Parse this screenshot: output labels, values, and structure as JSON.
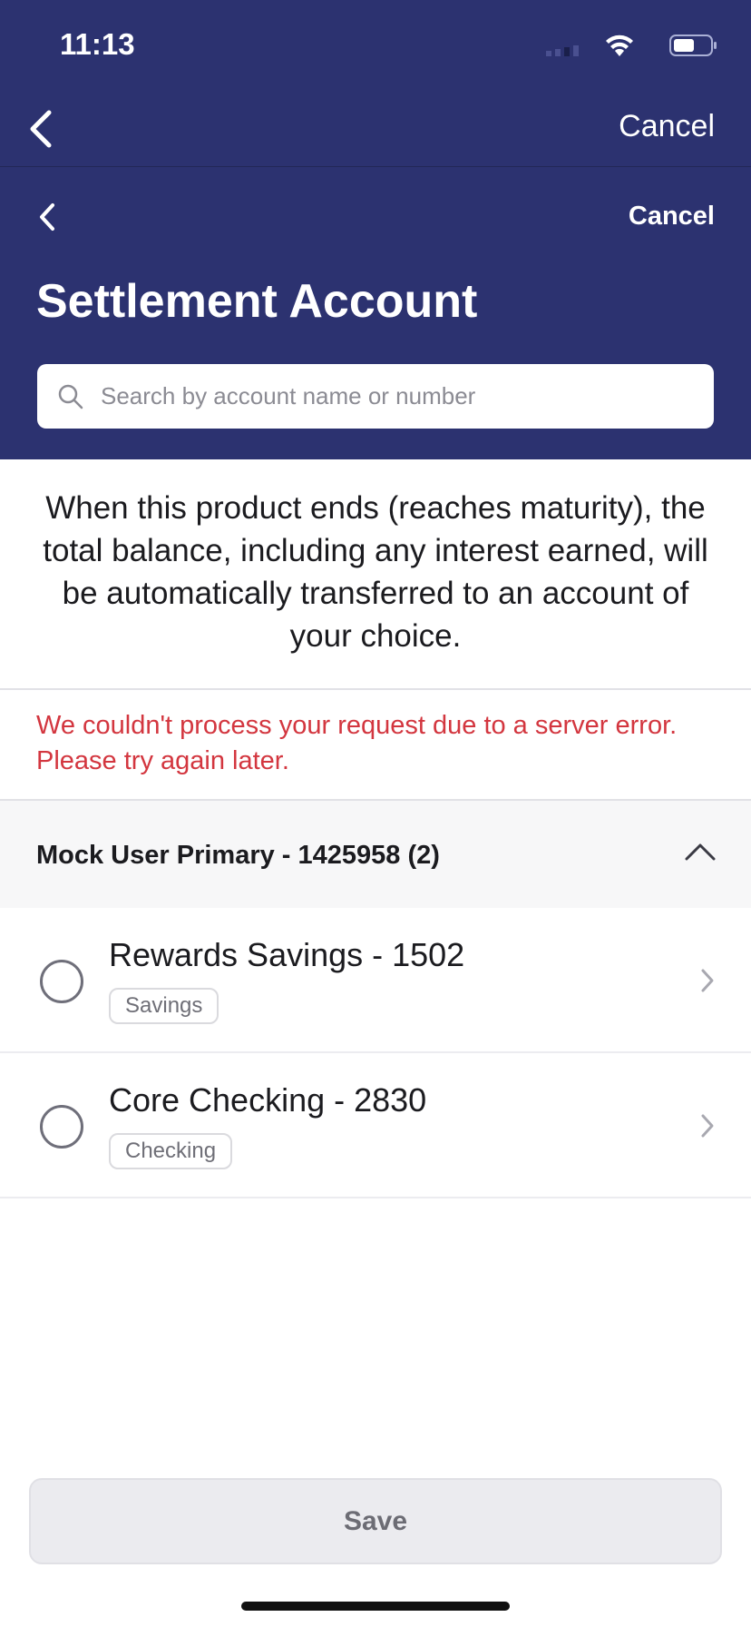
{
  "status_bar": {
    "time": "11:13"
  },
  "nav_outer": {
    "cancel_label": "Cancel"
  },
  "nav_inner": {
    "cancel_label": "Cancel"
  },
  "page_title": "Settlement Account",
  "search": {
    "placeholder": "Search by account name or number",
    "value": ""
  },
  "description": "When this product ends (reaches maturity), the total balance, including any interest earned, will be automatically transferred to an account of your choice.",
  "error": "We couldn't process your request due to a server error. Please try again later.",
  "group": {
    "title": "Mock User Primary - 1425958 (2)",
    "expanded": true
  },
  "accounts": [
    {
      "name": "Rewards Savings - 1502",
      "tag": "Savings",
      "selected": false
    },
    {
      "name": "Core Checking - 2830",
      "tag": "Checking",
      "selected": false
    }
  ],
  "save_label": "Save",
  "colors": {
    "header_bg": "#2c3270",
    "error": "#d3363f"
  }
}
